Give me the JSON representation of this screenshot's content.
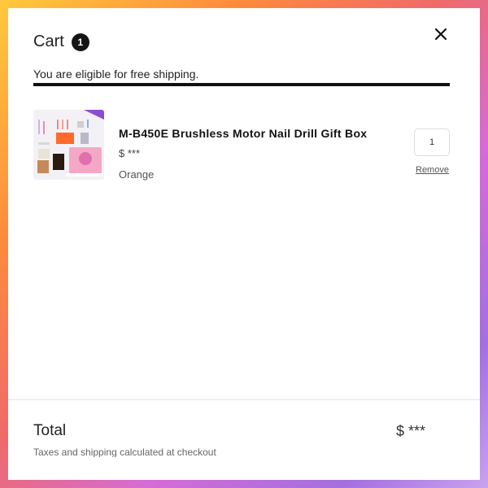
{
  "cart": {
    "title": "Cart",
    "count": "1",
    "close_icon": "close-icon"
  },
  "shipping": {
    "message": "You are eligible for free shipping.",
    "progress_fraction": 1.0
  },
  "items": [
    {
      "name": "M-B450E Brushless Motor Nail Drill Gift Box",
      "price": "$ ***",
      "variant": "Orange",
      "quantity": "1",
      "remove_label": "Remove",
      "image": "nail-drill-gift-box-image"
    }
  ],
  "footer": {
    "total_label": "Total",
    "total_value": "$ ***",
    "tax_note": "Taxes and shipping calculated at checkout"
  },
  "colors": {
    "accent": "#111111",
    "badge": "#151515"
  }
}
